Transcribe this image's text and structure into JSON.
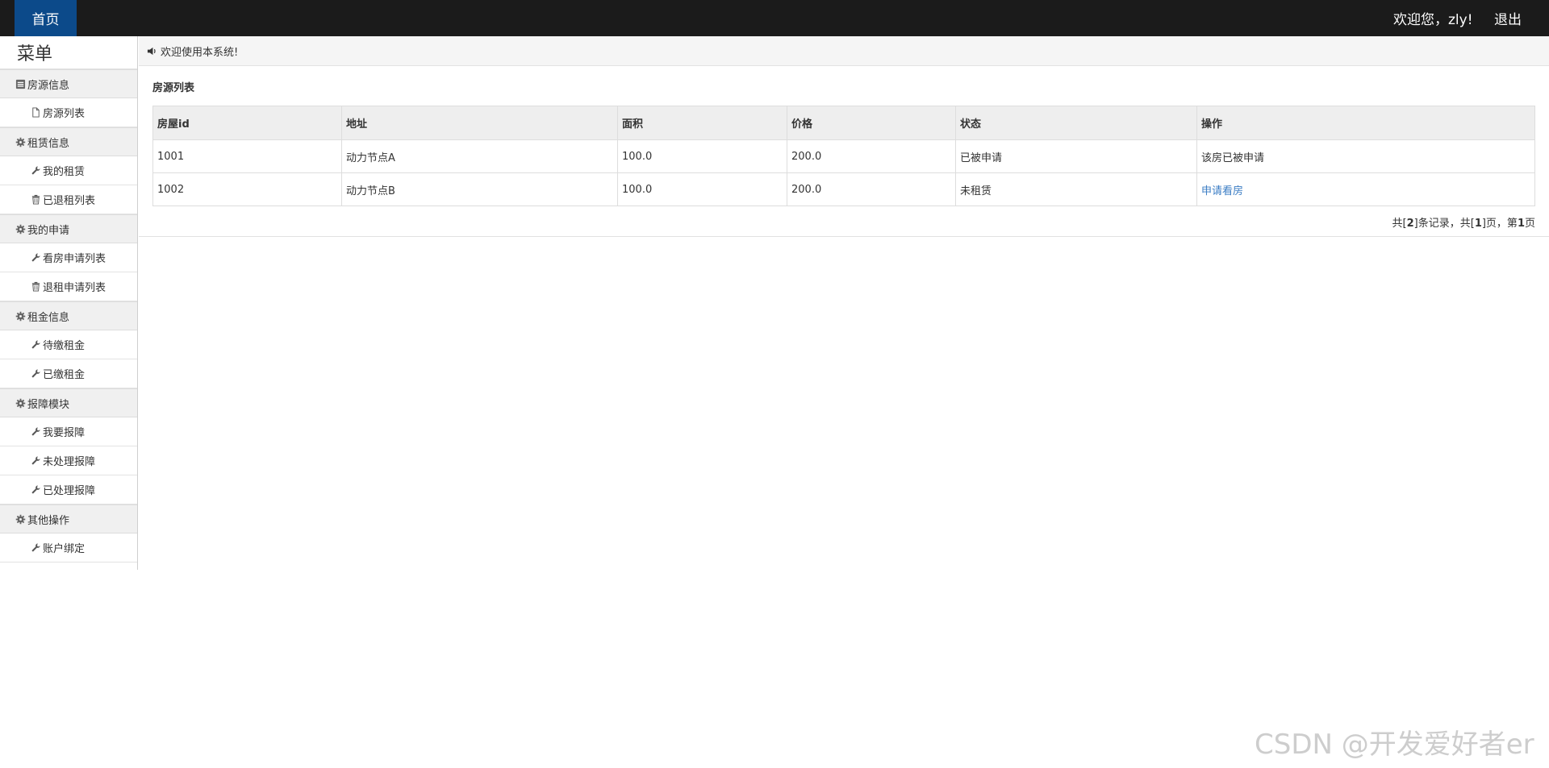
{
  "header": {
    "home_label": "首页",
    "welcome_text": "欢迎您，zly!",
    "logout_label": "退出"
  },
  "sidebar": {
    "title": "菜单",
    "groups": [
      {
        "label": "房源信息",
        "icon": "list-icon",
        "items": [
          {
            "label": "房源列表",
            "icon": "file-icon"
          }
        ]
      },
      {
        "label": "租赁信息",
        "icon": "gear-icon",
        "items": [
          {
            "label": "我的租赁",
            "icon": "wrench-icon"
          },
          {
            "label": "已退租列表",
            "icon": "trash-icon"
          }
        ]
      },
      {
        "label": "我的申请",
        "icon": "gear-icon",
        "items": [
          {
            "label": "看房申请列表",
            "icon": "wrench-icon"
          },
          {
            "label": "退租申请列表",
            "icon": "trash-icon"
          }
        ]
      },
      {
        "label": "租金信息",
        "icon": "gear-icon",
        "items": [
          {
            "label": "待缴租金",
            "icon": "wrench-icon"
          },
          {
            "label": "已缴租金",
            "icon": "wrench-icon"
          }
        ]
      },
      {
        "label": "报障模块",
        "icon": "gear-icon",
        "items": [
          {
            "label": "我要报障",
            "icon": "wrench-icon"
          },
          {
            "label": "未处理报障",
            "icon": "wrench-icon"
          },
          {
            "label": "已处理报障",
            "icon": "wrench-icon"
          }
        ]
      },
      {
        "label": "其他操作",
        "icon": "gear-icon",
        "items": [
          {
            "label": "账户绑定",
            "icon": "wrench-icon"
          }
        ]
      }
    ]
  },
  "notice": {
    "icon": "volume-icon",
    "text": "欢迎使用本系统!"
  },
  "main": {
    "section_title": "房源列表",
    "table": {
      "columns": [
        "房屋id",
        "地址",
        "面积",
        "价格",
        "状态",
        "操作"
      ],
      "rows": [
        {
          "id": "1001",
          "address": "动力节点A",
          "area": "100.0",
          "price": "200.0",
          "status": "已被申请",
          "action": "该房已被申请",
          "action_is_link": false
        },
        {
          "id": "1002",
          "address": "动力节点B",
          "area": "100.0",
          "price": "200.0",
          "status": "未租赁",
          "action": "申请看房",
          "action_is_link": true
        }
      ]
    },
    "pager": {
      "prefix": "共[",
      "total_records": "2",
      "mid1": "]条记录，共[",
      "total_pages": "1",
      "mid2": "]页，第",
      "current_page": "1",
      "suffix": "页"
    }
  },
  "watermark": "CSDN @开发爱好者er",
  "colors": {
    "topbar": "#1b1b1b",
    "home_tab": "#0c4a8a",
    "link": "#3b7dc4"
  }
}
